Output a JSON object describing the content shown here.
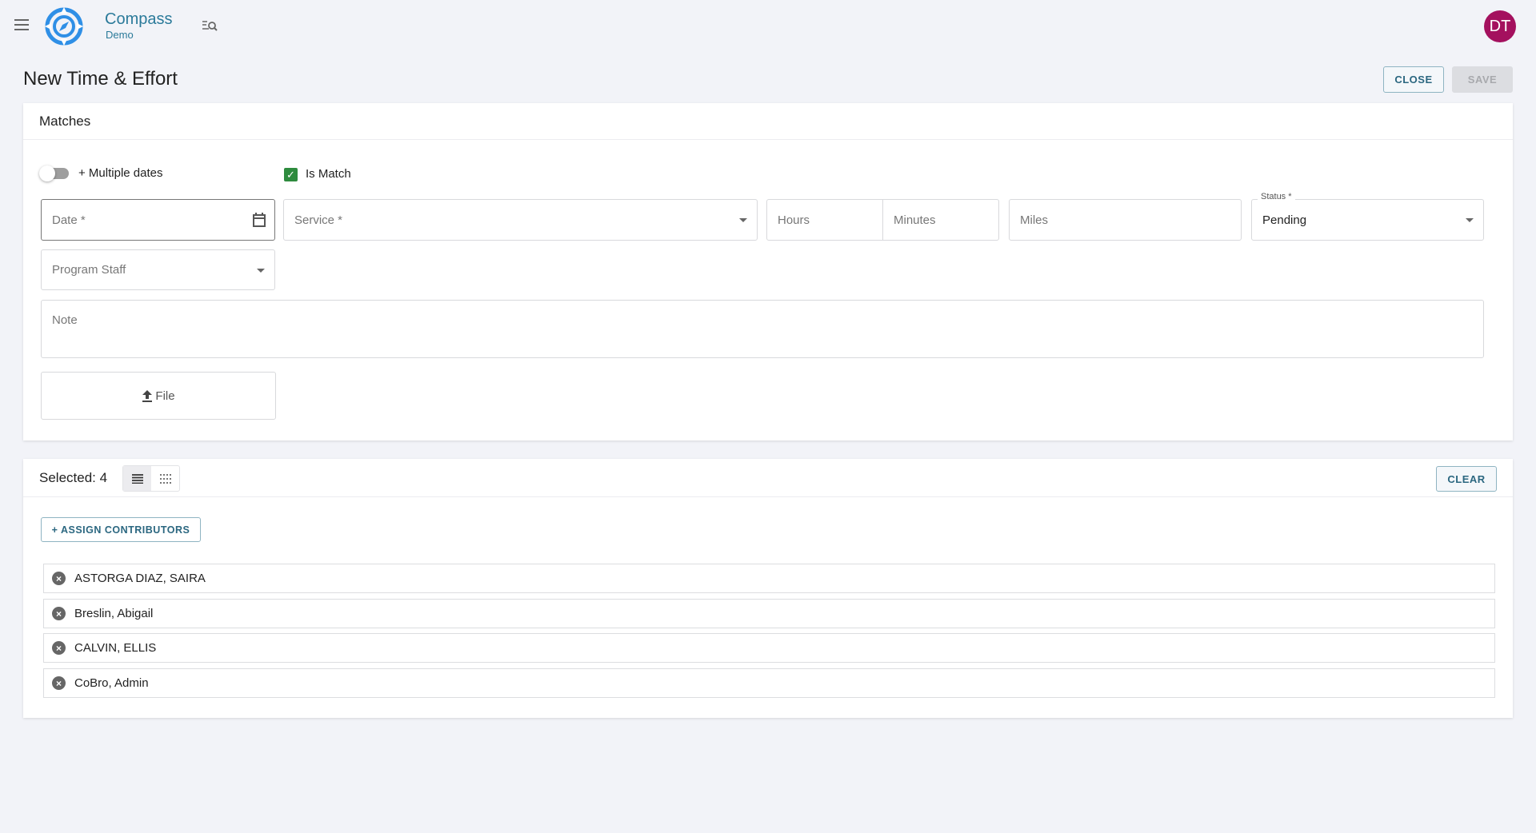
{
  "header": {
    "app_name": "Compass",
    "app_subtitle": "Demo",
    "avatar_initials": "DT"
  },
  "page": {
    "title": "New Time & Effort",
    "close_label": "CLOSE",
    "save_label": "SAVE"
  },
  "matches": {
    "title": "Matches",
    "multiple_dates_label": "+ Multiple dates",
    "multiple_dates_on": false,
    "is_match_label": "Is Match",
    "is_match_checked": true,
    "date_placeholder": "Date *",
    "service_placeholder": "Service *",
    "hours_placeholder": "Hours",
    "minutes_placeholder": "Minutes",
    "miles_placeholder": "Miles",
    "status_label": "Status *",
    "status_value": "Pending",
    "program_staff_placeholder": "Program Staff",
    "note_placeholder": "Note",
    "file_label": "File"
  },
  "contributors": {
    "selected_label": "Selected: 4",
    "clear_label": "CLEAR",
    "assign_label": "+ ASSIGN CONTRIBUTORS",
    "items": [
      {
        "name": "ASTORGA DIAZ, SAIRA"
      },
      {
        "name": "Breslin, Abigail"
      },
      {
        "name": "CALVIN, ELLIS"
      },
      {
        "name": "CoBro, Admin"
      }
    ]
  },
  "colors": {
    "brand": "#2b7a9a",
    "logo": "#2f8fe6",
    "avatar": "#a4105e",
    "check": "#2e8b3e"
  }
}
